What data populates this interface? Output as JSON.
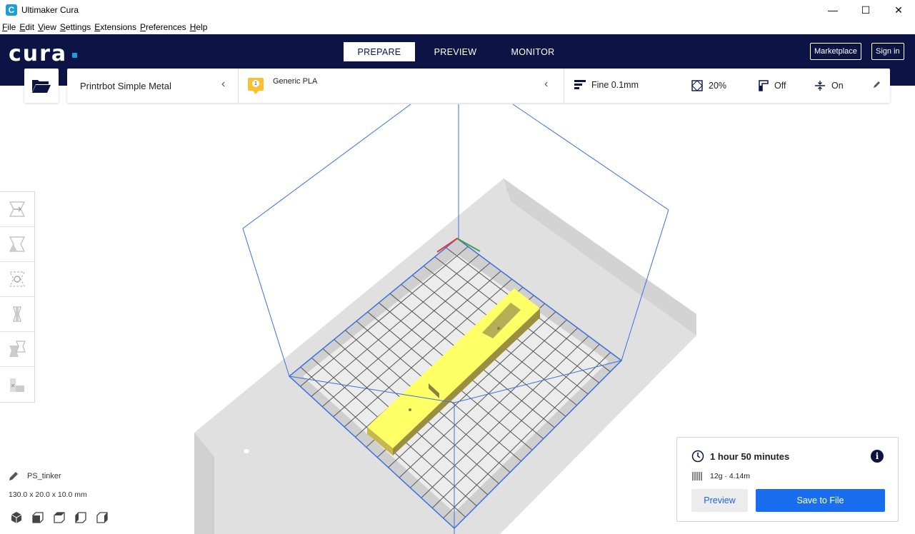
{
  "window": {
    "title": "Ultimaker Cura",
    "icon_letter": "C",
    "minimize": "—",
    "maximize": "☐",
    "close": "✕"
  },
  "menu": [
    "File",
    "Edit",
    "View",
    "Settings",
    "Extensions",
    "Preferences",
    "Help"
  ],
  "header": {
    "logo": "cura",
    "tabs": [
      "PREPARE",
      "PREVIEW",
      "MONITOR"
    ],
    "active_tab": "PREPARE",
    "marketplace_label": "Marketplace",
    "signin_label": "Sign in"
  },
  "stage": {
    "printer": "Printrbot Simple Metal",
    "extruder_number": "1",
    "material": "Generic PLA",
    "profile": "Fine 0.1mm",
    "infill": "20%",
    "support": "Off",
    "adhesion": "On"
  },
  "object": {
    "name": "PS_tinker",
    "dimensions": "130.0 x 20.0 x 10.0 mm"
  },
  "output": {
    "print_time": "1 hour 50 minutes",
    "material_estimate": "12g · 4.14m",
    "preview_label": "Preview",
    "save_label": "Save to File"
  },
  "colors": {
    "header_bg": "#0c1445",
    "accent_blue": "#196ef0",
    "model_yellow": "#ffff66",
    "material_badge": "#fbc02d"
  }
}
